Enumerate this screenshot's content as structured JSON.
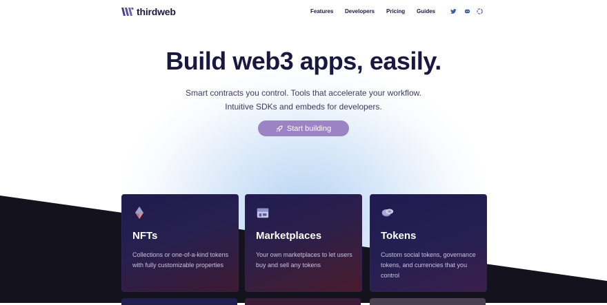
{
  "brand": {
    "name": "thirdweb"
  },
  "nav": {
    "links": [
      "Features",
      "Developers",
      "Pricing",
      "Guides"
    ],
    "social": [
      {
        "icon": "twitter-icon"
      },
      {
        "icon": "discord-icon"
      },
      {
        "icon": "github-icon"
      }
    ]
  },
  "hero": {
    "title": "Build web3 apps, easily.",
    "subtitle_line1": "Smart contracts you control. Tools that accelerate your workflow.",
    "subtitle_line2": "Intuitive SDKs and embeds for developers.",
    "cta_label": "Start building",
    "cta_icon": "rocket-icon"
  },
  "cards": [
    {
      "title": "NFTs",
      "description": "Collections or one-of-a-kind tokens with fully customizable properties",
      "icon": "nft-icon"
    },
    {
      "title": "Marketplaces",
      "description": "Your own marketplaces to let users buy and sell any tokens",
      "icon": "marketplace-icon"
    },
    {
      "title": "Tokens",
      "description": "Custom social tokens, governance tokens, and currencies that you control",
      "icon": "tokens-icon"
    }
  ],
  "colors": {
    "brand": "#9c84c4",
    "text": "#1b1741",
    "dark_bg": "#14121c",
    "social": "#3d5da8"
  }
}
